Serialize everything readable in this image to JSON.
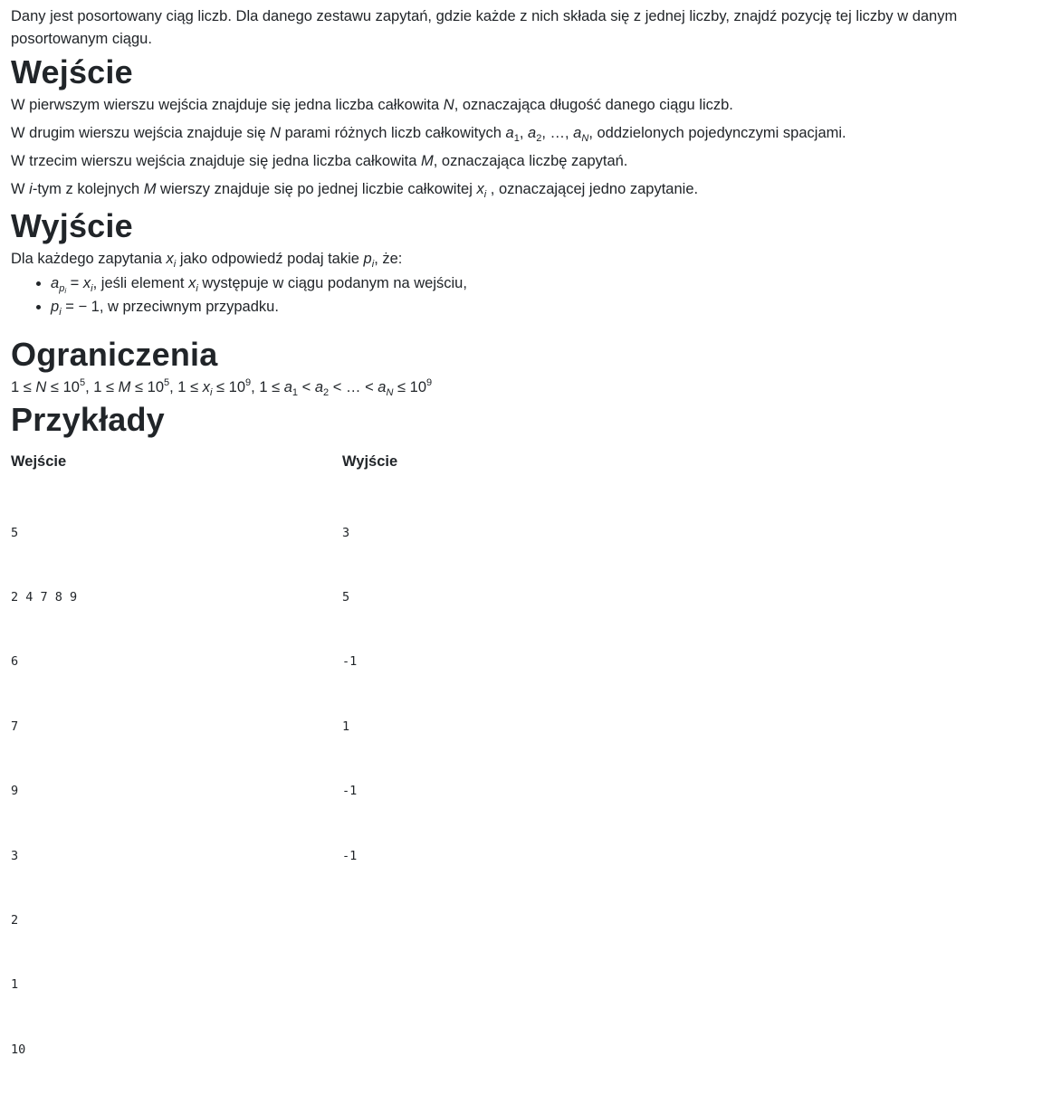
{
  "intro": "Dany jest posortowany ciąg liczb. Dla danego zestawu zapytań, gdzie każde z nich składa się z jednej liczby, znajdź pozycję tej liczby w danym posortowanym ciągu.",
  "input_section": {
    "heading": "Wejście",
    "line1_a": "W pierwszym wierszu wejścia znajduje się jedna liczba całkowita ",
    "var_N": "N",
    "line1_b": ", oznaczająca długość danego ciągu liczb.",
    "line2_a": "W drugim wierszu wejścia znajduje się ",
    "line2_b": " parami różnych liczb całkowitych ",
    "seq_a": "a",
    "sub_1": "1",
    "sub_2": "2",
    "sub_N": "N",
    "comma": ", ",
    "ellipsis": "…",
    "line2_c": ", oddzielonych pojedynczymi spacjami.",
    "line3_a": "W trzecim wierszu wejścia znajduje się jedna liczba całkowita ",
    "var_M": "M",
    "line3_b": ", oznaczająca liczbę zapytań.",
    "line4_pre": "W ",
    "var_i": "i",
    "line4_a": "-tym z kolejnych ",
    "line4_b": " wierszy znajduje się po jednej liczbie całkowitej ",
    "var_x": "x",
    "line4_c": " , oznaczającej jedno zapytanie."
  },
  "output_section": {
    "heading": "Wyjście",
    "lead_a": "Dla każdego zapytania ",
    "lead_b": " jako odpowiedź podaj takie ",
    "var_p": "p",
    "lead_c": ", że:",
    "item1_eq": " = ",
    "item1_text_a": ", jeśli element ",
    "item1_text_b": " występuje w ciągu podanym na wejściu,",
    "item2_eq": " =  − 1, w przeciwnym przypadku."
  },
  "constraints_section": {
    "heading": "Ograniczenia",
    "one": "1",
    "le": " ≤ ",
    "lt": " < ",
    "ten": "10",
    "exp5": "5",
    "exp9": "9",
    "sep": ", "
  },
  "examples_section": {
    "heading": "Przykłady",
    "input_label": "Wejście",
    "output_label": "Wyjście",
    "input_lines": [
      "5",
      "2 4 7 8 9",
      "6",
      "7",
      "9",
      "3",
      "2",
      "1",
      "10"
    ],
    "output_lines": [
      "3",
      "5",
      "-1",
      "1",
      "-1",
      "-1"
    ]
  }
}
